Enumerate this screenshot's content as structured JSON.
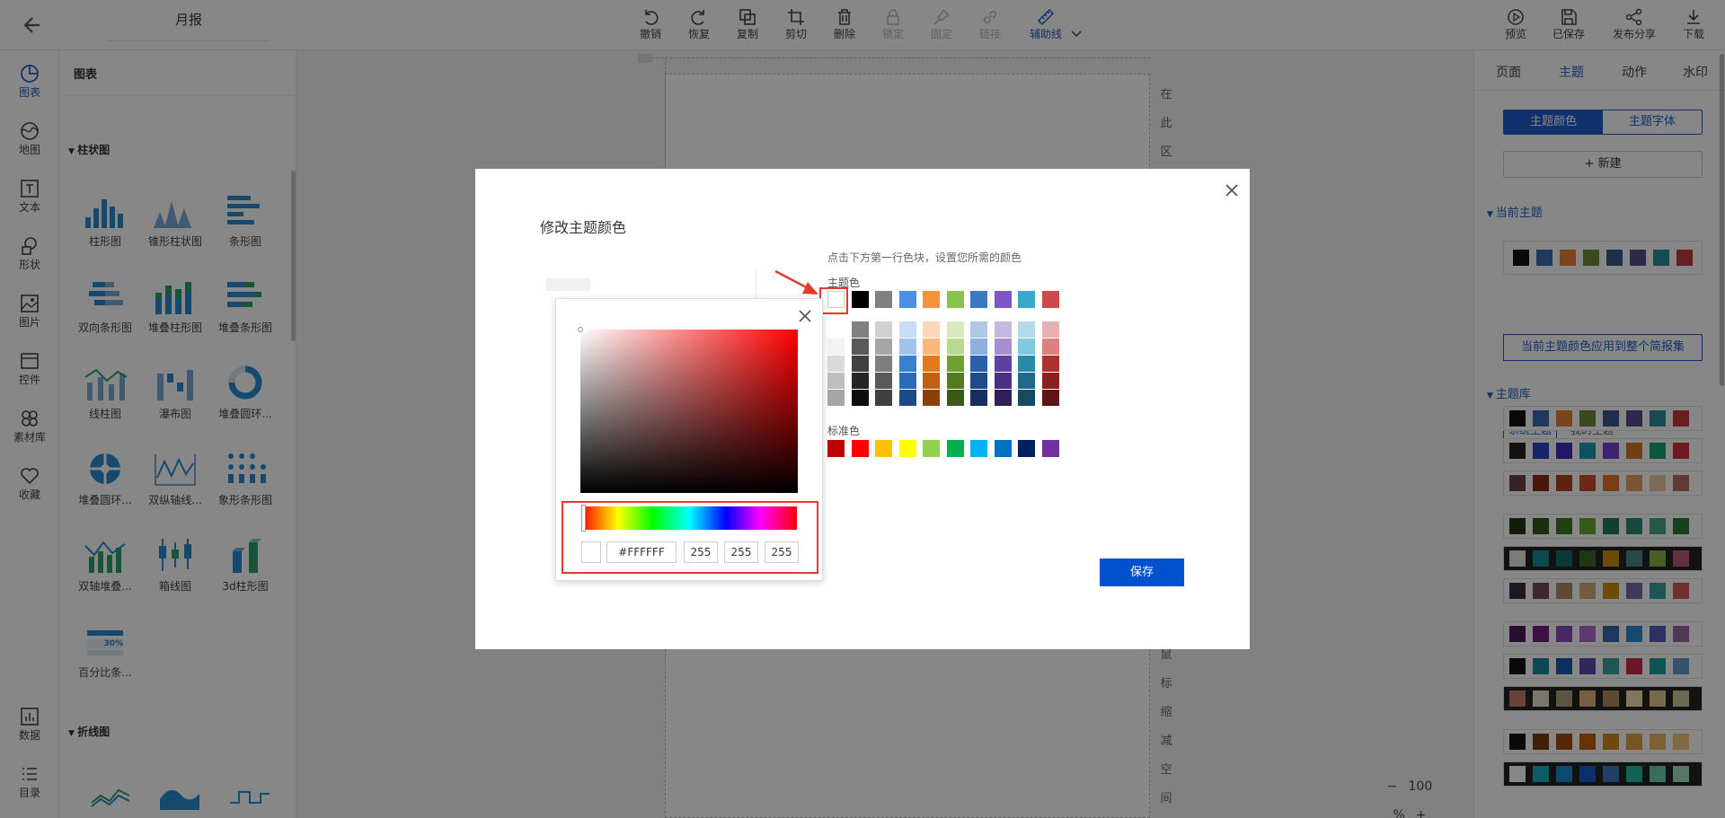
{
  "header": {
    "title": "月报",
    "toolbar": [
      {
        "label": "撤销",
        "icon": "undo-icon"
      },
      {
        "label": "恢复",
        "icon": "redo-icon"
      },
      {
        "label": "复制",
        "icon": "copy-icon"
      },
      {
        "label": "剪切",
        "icon": "crop-icon"
      },
      {
        "label": "删除",
        "icon": "trash-icon"
      },
      {
        "label": "锁定",
        "icon": "lock-icon"
      },
      {
        "label": "固定",
        "icon": "pin-icon"
      },
      {
        "label": "链接",
        "icon": "link-icon"
      },
      {
        "label": "辅助线",
        "icon": "ruler-icon"
      }
    ],
    "right_actions": [
      {
        "label": "预览",
        "icon": "play-icon"
      },
      {
        "label": "已保存",
        "icon": "save-icon"
      },
      {
        "label": "发布分享",
        "icon": "share-icon"
      },
      {
        "label": "下载",
        "icon": "download-icon"
      }
    ]
  },
  "left_nav": [
    {
      "label": "图表",
      "icon": "chart-icon"
    },
    {
      "label": "地图",
      "icon": "map-icon"
    },
    {
      "label": "文本",
      "icon": "text-icon"
    },
    {
      "label": "形状",
      "icon": "shape-icon"
    },
    {
      "label": "图片",
      "icon": "image-icon"
    },
    {
      "label": "控件",
      "icon": "widget-icon"
    },
    {
      "label": "素材库",
      "icon": "material-icon"
    },
    {
      "label": "收藏",
      "icon": "heart-icon"
    },
    {
      "label": "数据",
      "icon": "data-icon"
    },
    {
      "label": "目录",
      "icon": "list-icon"
    }
  ],
  "chart_panel": {
    "title": "图表",
    "section_bar": "柱状图",
    "section_line": "折线图",
    "items": [
      "柱形图",
      "锥形柱状图",
      "条形图",
      "双向条形图",
      "堆叠柱形图",
      "堆叠条形图",
      "线柱图",
      "瀑布图",
      "堆叠圆环...",
      "堆叠圆环...",
      "双纵轴线...",
      "象形条形图",
      "双轴堆叠...",
      "箱线图",
      "3d柱形图",
      "百分比条..."
    ],
    "pct_badge": "30%"
  },
  "canvas": {
    "vertical_top": [
      "在",
      "此",
      "区"
    ],
    "vertical_bottom": [
      "鼠",
      "标",
      "缩",
      "减",
      "空",
      "间"
    ],
    "zoom": "100 %",
    "zoom_minus": "−",
    "zoom_plus": "+"
  },
  "right_panel": {
    "tabs": [
      "页面",
      "主题",
      "动作",
      "水印"
    ],
    "seg": [
      "主题颜色",
      "主题字体"
    ],
    "new_button": "+ 新建",
    "current_theme": "当前主题",
    "apply_button": "当前主题颜色应用到整个简报集",
    "theme_library": "主题库",
    "sub_tabs": [
      "系统主题",
      "我的主题"
    ],
    "current_colors": [
      "#111111",
      "#3b6bb5",
      "#e6823a",
      "#6e8c3a",
      "#3c5a8c",
      "#5b4a8c",
      "#2e8f99",
      "#c0393b"
    ],
    "library": [
      {
        "bg": "#ffffff",
        "colors": [
          "#111111",
          "#3b6bb5",
          "#e6823a",
          "#6e8c3a",
          "#3c5a8c",
          "#5b4a8c",
          "#2e8f99",
          "#c0393b"
        ]
      },
      {
        "bg": "#ffffff",
        "colors": [
          "#222222",
          "#2a47c9",
          "#3a2fbf",
          "#1d9ab0",
          "#7a3fd0",
          "#d07a28",
          "#19a36c",
          "#d0303a"
        ]
      },
      {
        "bg": "#ffffff",
        "colors": [
          "#6b4040",
          "#8a2a10",
          "#b24020",
          "#cc4a30",
          "#e8742a",
          "#e6a060",
          "#e8c8a0",
          "#b07060"
        ]
      },
      {
        "bg": "#ffffff",
        "colors": [
          "#1f3a12",
          "#2e5a1a",
          "#3c7a20",
          "#6aa63a",
          "#1f7a5a",
          "#2a8c7a",
          "#4aa690",
          "#2a7a3a"
        ]
      },
      {
        "bg": "#222222",
        "colors": [
          "#e8e8e8",
          "#1a8a9a",
          "#1a6a6a",
          "#3a6a2a",
          "#d08a10",
          "#4a8a8a",
          "#8ab04a",
          "#c05a7a"
        ]
      },
      {
        "bg": "#ffffff",
        "colors": [
          "#3a2a4a",
          "#7a4a5a",
          "#b08a6a",
          "#d0b07a",
          "#d09010",
          "#7a6aaa",
          "#3aa0a0",
          "#d05a5a"
        ]
      },
      {
        "bg": "#ffffff",
        "colors": [
          "#4a1a5a",
          "#7a1a8a",
          "#8a4ac0",
          "#b06ad0",
          "#3a6ab0",
          "#2a8ad0",
          "#5a5ac0",
          "#9a6aa0"
        ]
      },
      {
        "bg": "#ffffff",
        "colors": [
          "#111111",
          "#1a8aa0",
          "#1a5ab0",
          "#5a4ab0",
          "#3aa0a0",
          "#d02a4a",
          "#1aa0a0",
          "#6a9ad0"
        ]
      },
      {
        "bg": "#222222",
        "colors": [
          "#c08070",
          "#e8e0d0",
          "#b0a080",
          "#e0b080",
          "#b09060",
          "#f0e0b0",
          "#e0c890",
          "#c8c8a0"
        ]
      },
      {
        "bg": "#ffffff",
        "colors": [
          "#111111",
          "#7a3a10",
          "#a04a10",
          "#c06010",
          "#d08a20",
          "#e0a040",
          "#e8b860",
          "#f0c880"
        ]
      },
      {
        "bg": "#222222",
        "colors": [
          "#ffffff",
          "#1ab0c0",
          "#1a8ad0",
          "#1a5ad0",
          "#3a7ac0",
          "#1ac0a0",
          "#6ad0b0",
          "#a0e0c0"
        ]
      }
    ]
  },
  "modal": {
    "title": "修改主题颜色",
    "hint": "点击下方第一行色块，设置您所需的颜色",
    "theme_label": "主题色",
    "standard_label": "标准色",
    "save": "保存",
    "theme_row": [
      "#ffffff",
      "#000000",
      "#808080",
      "#4a90e2",
      "#f5933a",
      "#8bc34a",
      "#3a78c4",
      "#7e57c2",
      "#3aa8c8",
      "#cc4a4a"
    ],
    "shade_rows": [
      [
        "#ffffff",
        "#808080",
        "#d0d0d0",
        "#c8dcf5",
        "#fcd8b8",
        "#d8e8c0",
        "#b0c8e8",
        "#c8b8e0",
        "#b0dce8",
        "#e8b0b0"
      ],
      [
        "#f2f2f2",
        "#595959",
        "#a6a6a6",
        "#a0c4ee",
        "#f9b87a",
        "#b9d98e",
        "#8bb0de",
        "#a890d0",
        "#80c8dc",
        "#dc8080"
      ],
      [
        "#d9d9d9",
        "#404040",
        "#7f7f7f",
        "#3a7fd0",
        "#e67a1a",
        "#6fa030",
        "#2a60a8",
        "#6040a0",
        "#2a8aa8",
        "#b03030"
      ],
      [
        "#bfbfbf",
        "#262626",
        "#595959",
        "#2a6ab8",
        "#c06010",
        "#557a20",
        "#1f4a88",
        "#4a3080",
        "#1f6a88",
        "#8a2020"
      ],
      [
        "#a6a6a6",
        "#0d0d0d",
        "#404040",
        "#1a4a88",
        "#8a4008",
        "#3a5a18",
        "#153060",
        "#302058",
        "#154a60",
        "#601515"
      ]
    ],
    "standard_row": [
      "#c00000",
      "#ff0000",
      "#ffc000",
      "#ffff00",
      "#92d050",
      "#00b050",
      "#00b0f0",
      "#0070c0",
      "#002060",
      "#7030a0"
    ]
  },
  "picker": {
    "hex": "#FFFFFF",
    "r": "255",
    "g": "255",
    "b": "255",
    "preview": "#ffffff"
  }
}
